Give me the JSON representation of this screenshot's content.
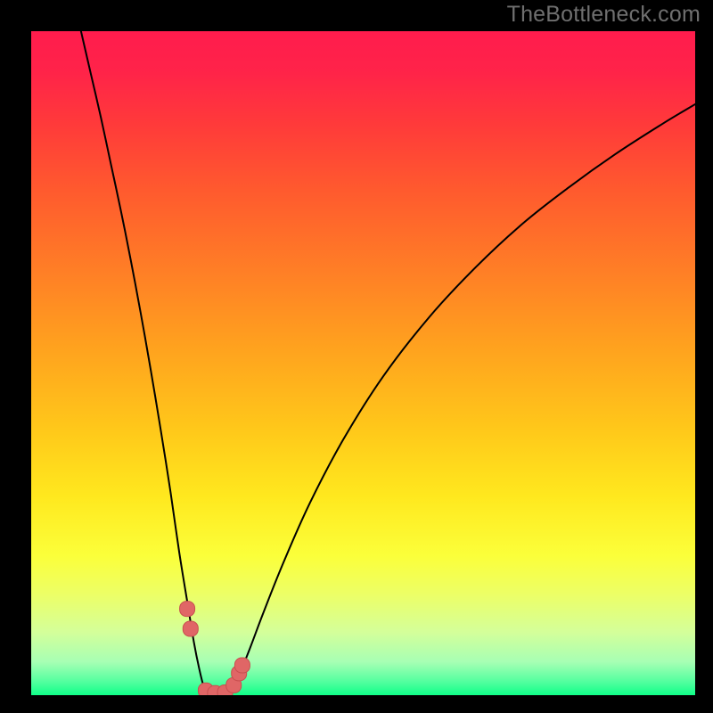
{
  "watermark": "TheBottleneck.com",
  "colors": {
    "frame": "#000000",
    "curve_stroke": "#000000",
    "marker_fill": "#e06666",
    "marker_stroke": "#c84f4f",
    "gradient_stops": [
      {
        "offset": 0.0,
        "color": "#ff1c4d"
      },
      {
        "offset": 0.06,
        "color": "#ff2349"
      },
      {
        "offset": 0.14,
        "color": "#ff3a3a"
      },
      {
        "offset": 0.24,
        "color": "#ff5a2e"
      },
      {
        "offset": 0.36,
        "color": "#ff7e26"
      },
      {
        "offset": 0.48,
        "color": "#ffa31e"
      },
      {
        "offset": 0.6,
        "color": "#ffc81a"
      },
      {
        "offset": 0.7,
        "color": "#ffe81e"
      },
      {
        "offset": 0.79,
        "color": "#fbff3a"
      },
      {
        "offset": 0.85,
        "color": "#ecff68"
      },
      {
        "offset": 0.905,
        "color": "#d4ff9a"
      },
      {
        "offset": 0.95,
        "color": "#a7ffb4"
      },
      {
        "offset": 0.98,
        "color": "#52ff9f"
      },
      {
        "offset": 1.0,
        "color": "#10ff88"
      }
    ]
  },
  "chart_data": {
    "type": "line",
    "title": "",
    "xlabel": "",
    "ylabel": "",
    "xlim": [
      0,
      100
    ],
    "ylim": [
      0,
      100
    ],
    "series": [
      {
        "name": "left-branch",
        "x": [
          7.5,
          9,
          10.5,
          12,
          13.5,
          15,
          16.5,
          18,
          19.5,
          21,
          22.3,
          23.6,
          24.5,
          25.3,
          26.0,
          26.5
        ],
        "y": [
          100,
          93.5,
          87,
          80,
          73,
          65.5,
          57.5,
          49,
          40,
          30.5,
          21.5,
          13.5,
          8.0,
          4.0,
          1.2,
          0.0
        ]
      },
      {
        "name": "right-branch",
        "x": [
          29.5,
          30.3,
          31.5,
          33,
          35,
          38,
          42,
          47,
          53,
          60,
          67,
          74,
          81,
          88,
          95,
          100
        ],
        "y": [
          0.0,
          1.2,
          3.5,
          7.2,
          12.5,
          20.0,
          29.0,
          38.5,
          48.0,
          57.0,
          64.5,
          71.0,
          76.5,
          81.5,
          86.0,
          89.0
        ]
      },
      {
        "name": "valley-floor",
        "x": [
          26.5,
          27.5,
          28.5,
          29.5
        ],
        "y": [
          0.0,
          0.0,
          0.0,
          0.0
        ]
      }
    ],
    "markers": [
      {
        "name": "m-left-upper",
        "x": 23.5,
        "y": 13.0
      },
      {
        "name": "m-left-lower",
        "x": 24.0,
        "y": 10.0
      },
      {
        "name": "m-floor-1",
        "x": 26.3,
        "y": 0.7
      },
      {
        "name": "m-floor-2",
        "x": 27.7,
        "y": 0.3
      },
      {
        "name": "m-floor-3",
        "x": 29.2,
        "y": 0.4
      },
      {
        "name": "m-floor-4",
        "x": 30.5,
        "y": 1.5
      },
      {
        "name": "m-right-upper",
        "x": 31.3,
        "y": 3.3
      },
      {
        "name": "m-right-lower",
        "x": 31.8,
        "y": 4.5
      }
    ]
  }
}
